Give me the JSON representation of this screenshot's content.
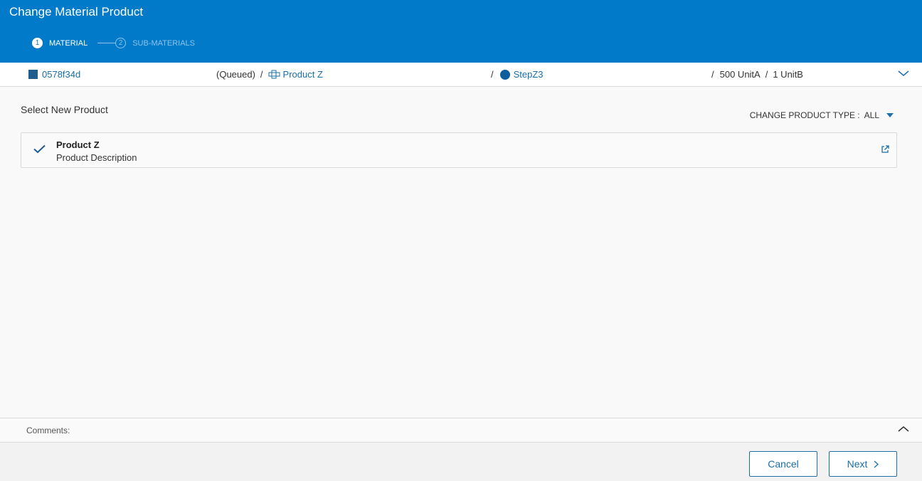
{
  "header": {
    "title": "Change Material Product",
    "steps": [
      {
        "num": "1",
        "label": "MATERIAL"
      },
      {
        "num": "2",
        "label": "SUB-MATERIALS"
      }
    ]
  },
  "context": {
    "material_id": "0578f34d",
    "status": "(Queued)",
    "product": "Product Z",
    "step": "StepZ3",
    "qty_a": "500 UnitA",
    "qty_b": "1 UnitB",
    "separator": "/"
  },
  "main": {
    "select_label": "Select New Product",
    "filter_label": "CHANGE PRODUCT TYPE :",
    "filter_value": "ALL",
    "products": [
      {
        "name": "Product Z",
        "description": "Product Description"
      }
    ]
  },
  "comments": {
    "label": "Comments:"
  },
  "footer": {
    "cancel_label": "Cancel",
    "next_label": "Next"
  },
  "colors": {
    "brand": "#007ac9",
    "link": "#1a6eaa"
  }
}
